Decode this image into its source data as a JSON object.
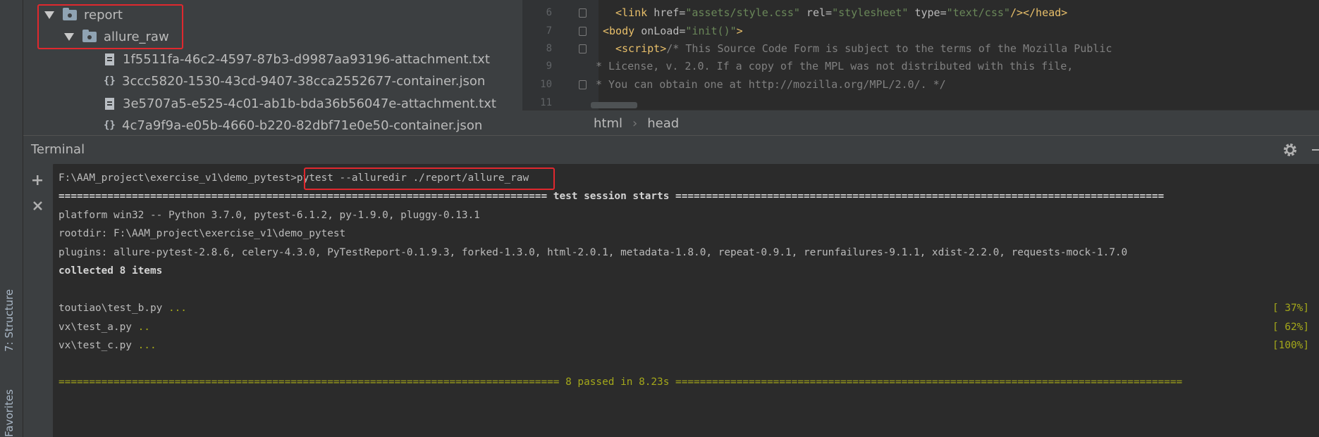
{
  "sidebar": {
    "structure_label": "7: Structure",
    "favorites_label": "Favorites"
  },
  "project_tree": {
    "folders": [
      "report",
      "allure_raw"
    ],
    "files": [
      {
        "name": "1f5511fa-46c2-4597-87b3-d9987aa93196-attachment.txt",
        "icon": "text-file-icon"
      },
      {
        "name": "3ccc5820-1530-43cd-9407-38cca2552677-container.json",
        "icon": "json-file-icon"
      },
      {
        "name": "3e5707a5-e525-4c01-ab1b-bda36b56047e-attachment.txt",
        "icon": "text-file-icon"
      },
      {
        "name": "4c7a9f9a-e05b-4660-b220-82dbf71e0e50-container.json",
        "icon": "json-file-icon"
      }
    ]
  },
  "editor": {
    "line_numbers": [
      "6",
      "7",
      "8",
      "9",
      "10",
      "11"
    ],
    "line6": {
      "open": "<link ",
      "a1": "href=",
      "v1": "\"assets/style.css\"",
      "a2": " rel=",
      "v2": "\"stylesheet\"",
      "a3": " type=",
      "v3": "\"text/css\"",
      "close": "/></head>"
    },
    "line7": {
      "open": "<body ",
      "a1": "onLoad=",
      "v1": "\"init()\"",
      "close": ">"
    },
    "line8": {
      "open": "<script>",
      "comment": "/* This Source Code Form is subject to the terms of the Mozilla Public"
    },
    "line9": "* License, v. 2.0. If a copy of the MPL was not distributed with this file,",
    "line10": "* You can obtain one at http://mozilla.org/MPL/2.0/. */"
  },
  "breadcrumb": {
    "items": [
      "html",
      "head"
    ],
    "separator": "›"
  },
  "terminal": {
    "title": "Terminal",
    "prompt": "F:\\AAM_project\\exercise_v1\\demo_pytest>",
    "command": "pytest --alluredir ./report/allure_raw",
    "session_start": "================================================================================ test session starts ================================================================================",
    "platform": "platform win32 -- Python 3.7.0, pytest-6.1.2, py-1.9.0, pluggy-0.13.1",
    "rootdir": "rootdir: F:\\AAM_project\\exercise_v1\\demo_pytest",
    "plugins": "plugins: allure-pytest-2.8.6, celery-4.3.0, PyTestReport-0.1.9.3, forked-1.3.0, html-2.0.1, metadata-1.8.0, repeat-0.9.1, rerunfailures-9.1.1, xdist-2.2.0, requests-mock-1.7.0",
    "collected": "collected 8 items",
    "tests": [
      {
        "file": "toutiao\\test_b.py ",
        "dots": "...",
        "pct": "[ 37%]"
      },
      {
        "file": "vx\\test_a.py ",
        "dots": "..",
        "pct": "[ 62%]"
      },
      {
        "file": "vx\\test_c.py ",
        "dots": "...",
        "pct": "[100%]"
      }
    ],
    "summary": "================================================================================== 8 passed in 8.23s ==================================================================================="
  },
  "colors": {
    "accent_red": "#e0282e",
    "pass_green": "#a4a81a"
  }
}
